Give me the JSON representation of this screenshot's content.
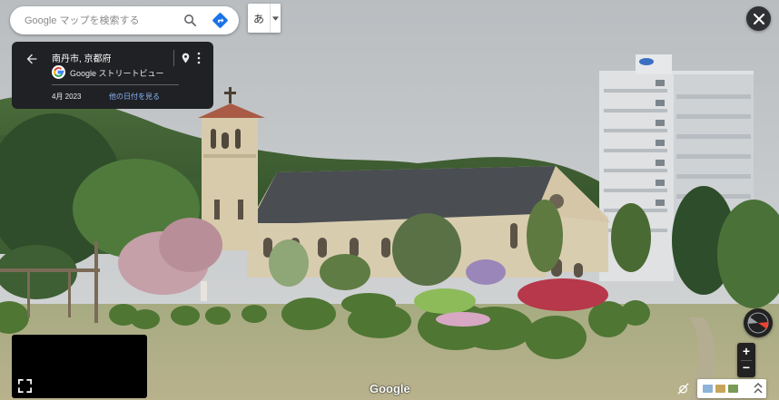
{
  "search": {
    "placeholder": "Google マップを検索する",
    "value": ""
  },
  "ime": {
    "label": "あ"
  },
  "location_card": {
    "place_title": "南丹市, 京都府",
    "service_label": "Google ストリートビュー",
    "capture_date": "4月 2023",
    "see_more_dates_label": "他の日付を見る"
  },
  "zoom": {
    "in_label": "+",
    "out_label": "−"
  },
  "watermark": "Google",
  "colors": {
    "card_background": "#202124",
    "link_blue": "#8ab4f8",
    "directions_blue": "#1a73e8",
    "compass_red": "#ea4335"
  },
  "icons": [
    "search-icon",
    "directions-icon",
    "chevron-down-icon",
    "back-arrow-icon",
    "google-logo-icon",
    "pin-icon",
    "more-vert-icon",
    "close-icon",
    "expand-icon",
    "compass-icon",
    "no-photo-icon",
    "expand-up-icon"
  ]
}
